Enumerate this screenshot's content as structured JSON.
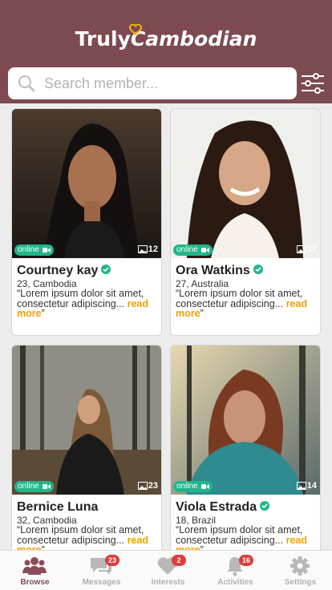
{
  "app": {
    "logo_part1": "Truly",
    "logo_part2": "Cambodian"
  },
  "search": {
    "placeholder": "Search member..."
  },
  "members": [
    {
      "name": "Courtney kay",
      "age_location": "23, Cambodia",
      "status": "online",
      "photo_count": "12",
      "verified": true,
      "desc_text": "“Lorem ipsum dolor sit amet, consectetur adipiscing...",
      "read_more": "read more",
      "close_quote": "”"
    },
    {
      "name": "Ora Watkins",
      "age_location": "27, Australia",
      "status": "online",
      "photo_count": "17",
      "verified": true,
      "desc_text": "“Lorem ipsum dolor sit amet, consectetur adipiscing...",
      "read_more": "read more",
      "close_quote": "”"
    },
    {
      "name": "Bernice Luna",
      "age_location": "32, Cambodia",
      "status": "online",
      "photo_count": "23",
      "verified": false,
      "desc_text": "“Lorem ipsum dolor sit amet, consectetur adipiscing...",
      "read_more": "read more",
      "close_quote": "”"
    },
    {
      "name": "Viola Estrada",
      "age_location": "18, Brazil",
      "status": "online",
      "photo_count": "14",
      "verified": true,
      "desc_text": "“Lorem ipsum dolor sit amet, consectetur adipiscing...",
      "read_more": "read more",
      "close_quote": "”"
    }
  ],
  "tabs": [
    {
      "label": "Browse",
      "icon": "users-icon",
      "badge": null,
      "active": true
    },
    {
      "label": "Messages",
      "icon": "chat-icon",
      "badge": "23",
      "active": false
    },
    {
      "label": "Interests",
      "icon": "heart-icon",
      "badge": "2",
      "active": false
    },
    {
      "label": "Activities",
      "icon": "bell-icon",
      "badge": "16",
      "active": false
    },
    {
      "label": "Settings",
      "icon": "gear-icon",
      "badge": null,
      "active": false
    }
  ],
  "colors": {
    "brand": "#7d4a52",
    "online": "#22b58a",
    "read_more": "#f0a200",
    "badge": "#e03c3c"
  }
}
